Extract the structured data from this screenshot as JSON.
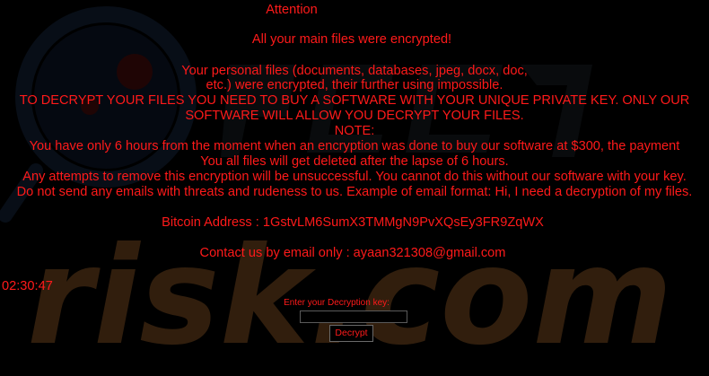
{
  "ransom_note": {
    "heading": "Attention",
    "subheading": "All your main files were encrypted!",
    "lines": [
      "Your personal files (documents, databases, jpeg, docx, doc,",
      "etc.) were encrypted, their further using impossible.",
      "TO DECRYPT YOUR FILES YOU NEED TO BUY A SOFTWARE WITH YOUR UNIQUE PRIVATE KEY. ONLY OUR",
      "SOFTWARE WILL ALLOW YOU DECRYPT YOUR FILES.",
      "NOTE:",
      "You have only 6 hours from the moment when an encryption was done to buy our software at $300, the payment",
      "You all files will get deleted after the lapse of 6 hours.",
      "Any attempts to remove this encryption will be unsuccessful. You cannot do this without our software with your key.",
      "Do not send any emails with threats and rudeness to us. Example of email format: Hi, I need a decryption of my files."
    ],
    "bitcoin_line": "Bitcoin Address : 1GstvLM6SumX3TMMgN9PvXQsEy3FR9ZqWX",
    "contact_line": "Contact us by email only : ayaan321308@gmail.com"
  },
  "timer": {
    "value": "02:30:47"
  },
  "decrypt_form": {
    "label": "Enter your Decryption key:",
    "input_value": "",
    "button_label": "Decrypt"
  },
  "watermark": {
    "text": "risk.com"
  },
  "colors": {
    "background": "#000000",
    "text": "#ff1a1a",
    "watermark": "#3a2410"
  }
}
